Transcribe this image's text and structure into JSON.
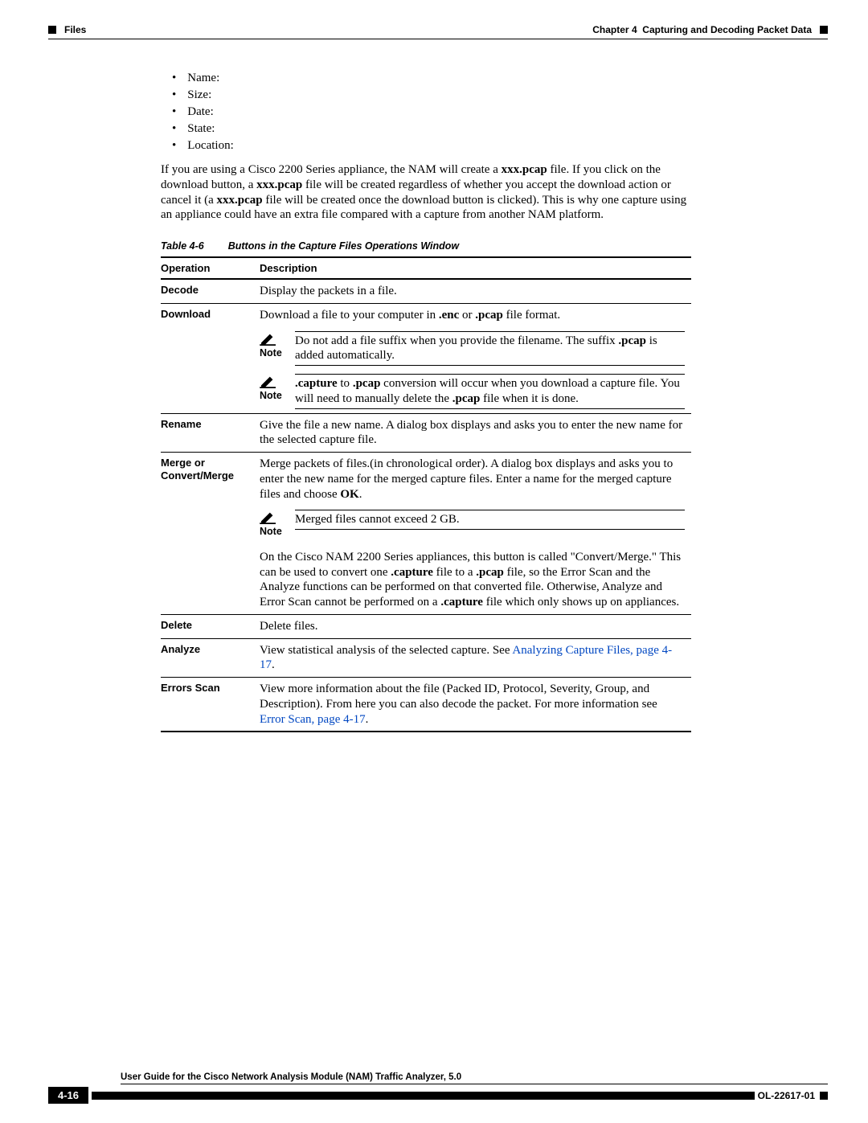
{
  "header": {
    "section": "Files",
    "chapter_label": "Chapter 4",
    "chapter_title": "Capturing and Decoding Packet Data"
  },
  "bullets": [
    "Name:",
    "Size:",
    "Date:",
    "State:",
    "Location:"
  ],
  "paragraph": {
    "p1": "If you are using a Cisco 2200 Series appliance, the NAM will create a ",
    "p1b": "xxx.pcap",
    "p2": " file. If you click on the download button, a ",
    "p2b": "xxx.pcap",
    "p3": " file will be created regardless of whether you accept the download action or cancel it (a ",
    "p3b": "xxx.pcap",
    "p4": " file will be created once the download button is clicked). This is why one capture using an appliance could have an extra file compared with a capture from another NAM platform."
  },
  "table": {
    "caption_num": "Table 4-6",
    "caption_title": "Buttons in the Capture Files Operations Window",
    "h1": "Operation",
    "h2": "Description",
    "decode_op": "Decode",
    "decode_desc": "Display the packets in a file.",
    "download_op": "Download",
    "download_line1": "Download a file to your computer in ",
    "download_enc": ".enc",
    "download_or": " or ",
    "download_pcap": ".pcap",
    "download_line1_end": " file format.",
    "note_label": "Note",
    "download_note1_a": "Do not add a file suffix when you provide the filename. The suffix ",
    "download_note1_b": ".pcap",
    "download_note1_c": " is added automatically.",
    "download_note2_a": ".capture",
    "download_note2_b": " to ",
    "download_note2_c": ".pcap",
    "download_note2_d": " conversion will occur when you download a capture file.  You will need to manually delete the ",
    "download_note2_e": ".pcap",
    "download_note2_f": " file when it is done.",
    "rename_op": "Rename",
    "rename_desc": "Give the file a new name. A dialog box displays and asks you to enter the new name for the selected capture file.",
    "merge_op": "Merge or Convert/Merge",
    "merge_a": "Merge packets of files.(in chronological order). A dialog box displays and asks you to enter the new name for the merged capture files. Enter a name for the merged capture files and choose ",
    "merge_ok": "OK",
    "merge_b": ".",
    "merge_note": "Merged files cannot exceed 2 GB.",
    "merge_p2_a": "On the Cisco NAM 2200 Series appliances, this button is called \"Convert/Merge.\" This can be used to convert one ",
    "merge_p2_b": ".capture",
    "merge_p2_c": " file to a ",
    "merge_p2_d": ".pcap",
    "merge_p2_e": " file, so the Error Scan and the Analyze functions can be performed on that converted file. Otherwise, Analyze and Error Scan cannot be performed on a ",
    "merge_p2_f": ".capture",
    "merge_p2_g": " file which only shows up on appliances.",
    "delete_op": "Delete",
    "delete_desc": "Delete files.",
    "analyze_op": "Analyze",
    "analyze_a": "View statistical analysis of the selected capture. See ",
    "analyze_link": "Analyzing Capture Files, page 4-17",
    "analyze_b": ".",
    "errors_op": "Errors Scan",
    "errors_a": "View more information about the file (Packed ID, Protocol, Severity, Group, and Description). From here you can also decode the packet. For more information see ",
    "errors_link": "Error Scan, page 4-17",
    "errors_b": "."
  },
  "footer": {
    "guide": "User Guide for the Cisco Network Analysis Module (NAM) Traffic Analyzer, 5.0",
    "page": "4-16",
    "doc": "OL-22617-01"
  }
}
